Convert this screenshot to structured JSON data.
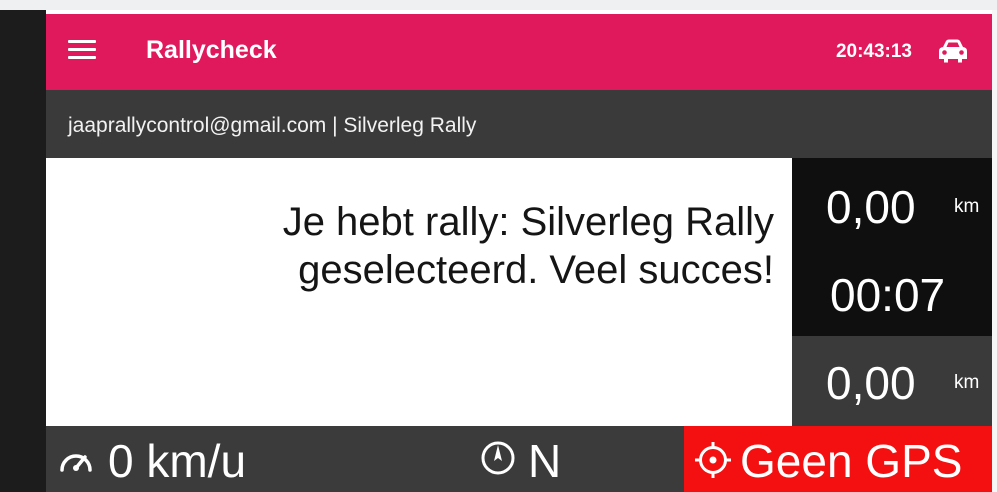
{
  "appbar": {
    "title": "Rallycheck",
    "time": "20:43:13",
    "menu_icon": "menu-icon",
    "car_icon": "car-icon",
    "background_color": "#e0195c"
  },
  "account": {
    "label": "jaaprallycontrol@gmail.com | Silverleg Rally"
  },
  "message": {
    "text": "Je hebt rally: Silverleg Rally geselecteerd. Veel succes!"
  },
  "stats": {
    "distance_total": {
      "value": "0,00",
      "unit": "km"
    },
    "elapsed_time": "00:07",
    "distance_leg": {
      "value": "0,00",
      "unit": "km"
    }
  },
  "statusbar": {
    "speed": "0 km/u",
    "speed_icon": "speedometer-icon",
    "heading": "N",
    "heading_icon": "compass-icon",
    "gps_status": "Geen GPS",
    "gps_icon": "gps-crosshair-icon",
    "gps_color": "#f41010"
  }
}
